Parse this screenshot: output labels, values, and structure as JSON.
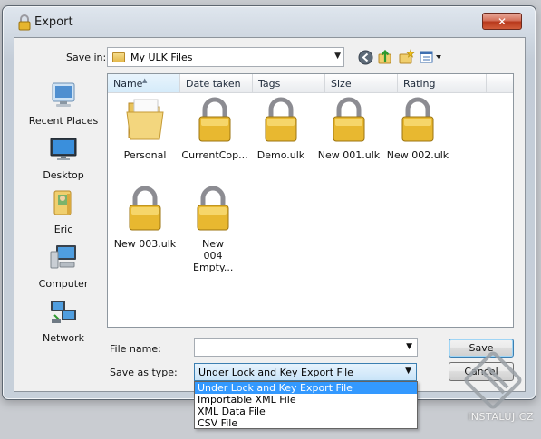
{
  "window": {
    "title": "Export",
    "close_glyph": "✕"
  },
  "toolbar": {
    "save_in_label": "Save in:",
    "save_in_value": "My ULK Files",
    "icons": [
      "back-icon",
      "up-folder-icon",
      "new-folder-icon",
      "views-menu-icon"
    ]
  },
  "places": [
    {
      "label": "Recent Places",
      "icon": "recent-places-icon"
    },
    {
      "label": "Desktop",
      "icon": "desktop-icon"
    },
    {
      "label": "Eric",
      "icon": "user-folder-icon"
    },
    {
      "label": "Computer",
      "icon": "computer-icon"
    },
    {
      "label": "Network",
      "icon": "network-icon"
    }
  ],
  "columns": [
    "Name",
    "Date taken",
    "Tags",
    "Size",
    "Rating"
  ],
  "files": [
    {
      "name": "Personal",
      "icon": "folder-icon"
    },
    {
      "name": "CurrentCop...",
      "icon": "padlock-icon"
    },
    {
      "name": "Demo.ulk",
      "icon": "padlock-icon"
    },
    {
      "name": "New 001.ulk",
      "icon": "padlock-icon"
    },
    {
      "name": "New 002.ulk",
      "icon": "padlock-icon"
    },
    {
      "name": "New 003.ulk",
      "icon": "padlock-icon"
    },
    {
      "name": "New 004 Empty...",
      "icon": "padlock-icon"
    }
  ],
  "form": {
    "file_name_label": "File name:",
    "file_name_value": "",
    "save_as_type_label": "Save as type:",
    "save_as_type_value": "Under Lock and Key Export File",
    "type_options": [
      "Under Lock and Key Export File",
      "Importable XML File",
      "XML Data File",
      "CSV File"
    ],
    "selected_option_index": 0
  },
  "buttons": {
    "save": "Save",
    "cancel": "Cancel"
  },
  "watermark": {
    "text": "INSTALUJ.CZ"
  },
  "colors": {
    "selection": "#3399ff",
    "lock_gold": "#e8b830",
    "folder": "#f0cf6e"
  }
}
